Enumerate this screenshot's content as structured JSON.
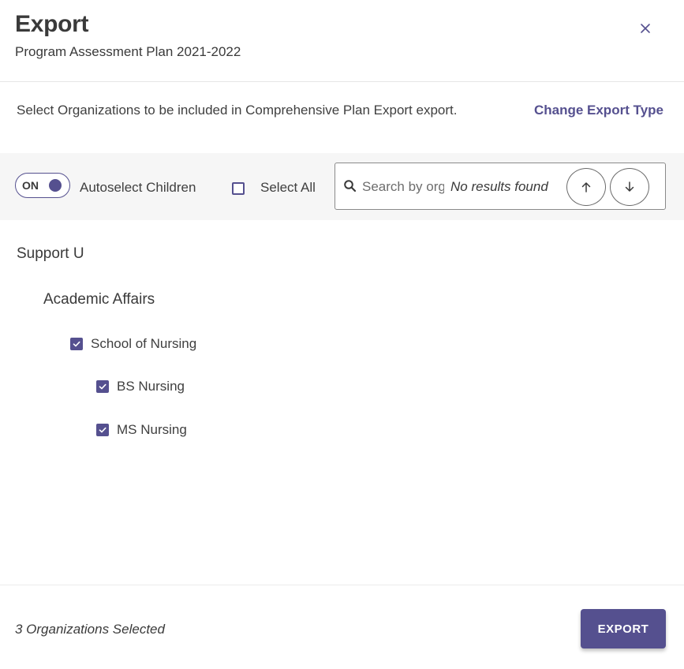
{
  "colors": {
    "accent": "#55508f",
    "text": "#3f3f3f",
    "toolbar_bg": "#f6f6f6"
  },
  "header": {
    "title": "Export",
    "subtitle": "Program Assessment Plan 2021-2022",
    "close_icon": "close-icon"
  },
  "intro": {
    "text": "Select Organizations to be included in Comprehensive Plan Export export.",
    "change_link": "Change Export Type"
  },
  "toolbar": {
    "toggle_state": "ON",
    "autoselect_label": "Autoselect Children",
    "select_all_label": "Select All",
    "select_all_checked": false,
    "search": {
      "placeholder": "Search by organization",
      "value": "",
      "status": "No results found",
      "icon": "search-icon",
      "prev_icon": "arrow-up-icon",
      "next_icon": "arrow-down-icon"
    }
  },
  "tree": {
    "root": {
      "label": "Support U"
    },
    "level1": {
      "label": "Academic Affairs"
    },
    "items": [
      {
        "label": "School of Nursing",
        "checked": true
      },
      {
        "label": "BS Nursing",
        "checked": true
      },
      {
        "label": "MS Nursing",
        "checked": true
      }
    ]
  },
  "footer": {
    "selected_count": "3 Organizations Selected",
    "export_label": "EXPORT"
  }
}
